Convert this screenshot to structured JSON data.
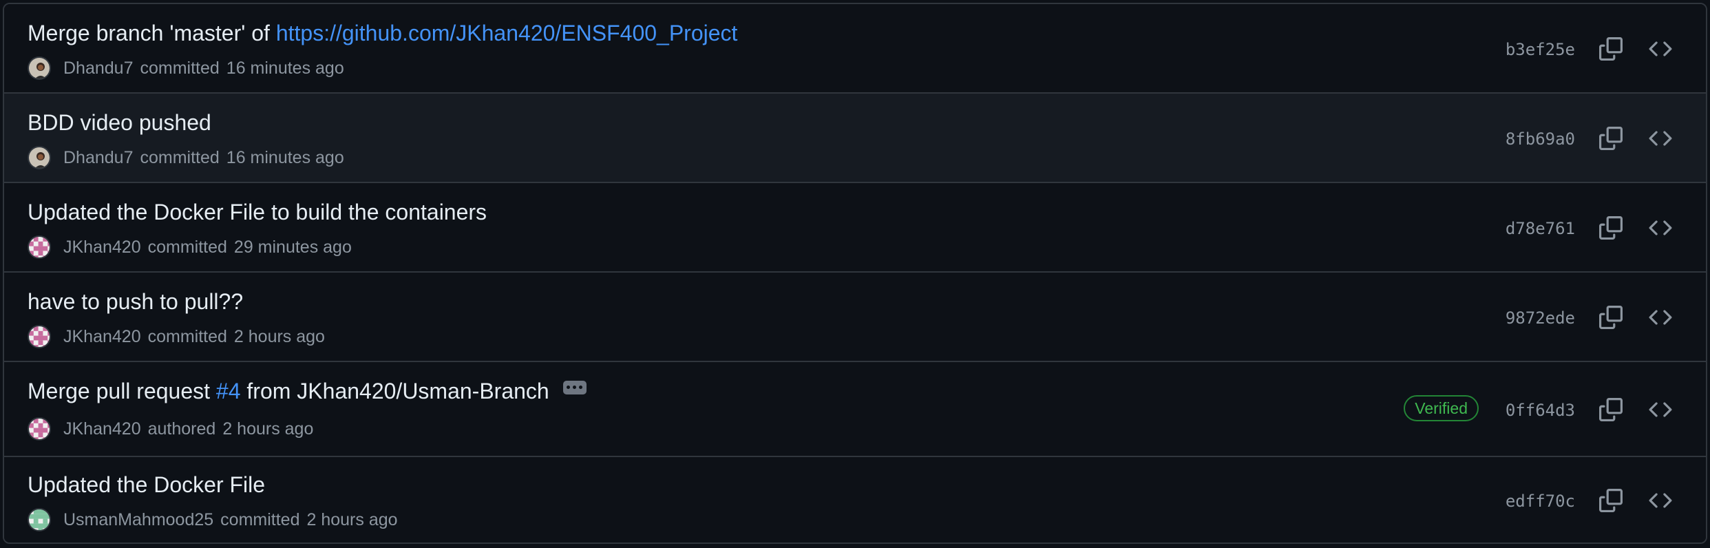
{
  "colors": {
    "background": "#0d1117",
    "row_hover": "#161b22",
    "border": "#30363d",
    "title": "#e6edf3",
    "muted": "#8d96a0",
    "link": "#4493f8",
    "verified": "#3fb950"
  },
  "commits": [
    {
      "title_text": "Merge branch 'master' of ",
      "title_link": "https://github.com/JKhan420/ENSF400_Project",
      "author": "Dhandu7",
      "verb": "committed",
      "time": "16 minutes ago",
      "sha": "b3ef25e",
      "avatar_icon": "photo-avatar-icon"
    },
    {
      "title_text": "BDD video pushed",
      "author": "Dhandu7",
      "verb": "committed",
      "time": "16 minutes ago",
      "sha": "8fb69a0",
      "avatar_icon": "photo-avatar-icon"
    },
    {
      "title_text": "Updated the Docker File to build the containers",
      "author": "JKhan420",
      "verb": "committed",
      "time": "29 minutes ago",
      "sha": "d78e761",
      "avatar_icon": "identicon-pink-icon"
    },
    {
      "title_text": "have to push to pull??",
      "author": "JKhan420",
      "verb": "committed",
      "time": "2 hours ago",
      "sha": "9872ede",
      "avatar_icon": "identicon-pink-icon"
    },
    {
      "title_before": "Merge pull request ",
      "title_pr": "#4",
      "title_after": " from JKhan420/Usman-Branch",
      "author": "JKhan420",
      "verb": "authored",
      "time": "2 hours ago",
      "sha": "0ff64d3",
      "badge": "Verified",
      "avatar_icon": "identicon-pink-icon"
    },
    {
      "title_text": "Updated the Docker File",
      "author": "UsmanMahmood25",
      "verb": "committed",
      "time": "2 hours ago",
      "sha": "edff70c",
      "avatar_icon": "identicon-green-icon"
    }
  ]
}
